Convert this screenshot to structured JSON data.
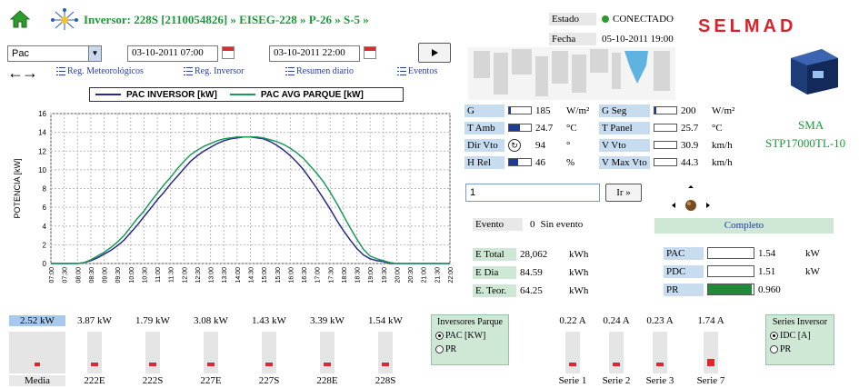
{
  "header": {
    "breadcrumb": "Inversor: 228S [2110054826] » EISEG-228 » P-26 » S-5 »"
  },
  "controls": {
    "variable_select": "Pac",
    "start_datetime": "03-10-2011 07:00",
    "end_datetime": "03-10-2011 22:00",
    "links": [
      "Reg. Meteorológicos",
      "Reg. Inversor",
      "Resumen diario",
      "Eventos"
    ]
  },
  "status": {
    "estado_label": "Estado",
    "estado_value": "CONECTADO",
    "fecha_label": "Fecha",
    "fecha_value": "05-10-2011 19:00",
    "brand": "SELMAD",
    "device_name_1": "SMA",
    "device_name_2": "STP17000TL-10",
    "status_color": "#2e9a2e"
  },
  "weather": {
    "left": [
      {
        "label": "G",
        "value": "185",
        "unit": "W/m²",
        "level": 0.1
      },
      {
        "label": "T Amb",
        "value": "24.7",
        "unit": "°C",
        "level": 0.5
      },
      {
        "label": "Dir Vto",
        "value": "94",
        "unit": "°",
        "level": null
      },
      {
        "label": "H Rel",
        "value": "46",
        "unit": "%",
        "level": 0.4
      }
    ],
    "right": [
      {
        "label": "G Seg",
        "value": "200",
        "unit": "W/m²",
        "level": 0.1
      },
      {
        "label": "T Panel",
        "value": "25.7",
        "unit": "°C",
        "level": 0.0
      },
      {
        "label": "V Vto",
        "value": "30.9",
        "unit": "km/h",
        "level": 0.0
      },
      {
        "label": "V Max Vto",
        "value": "44.3",
        "unit": "km/h",
        "level": 0.0
      }
    ]
  },
  "search": {
    "value": "1",
    "go_label": "Ir »"
  },
  "evento": {
    "label": "Evento",
    "count": "0",
    "text": "Sin evento"
  },
  "completo": {
    "label": "Completo",
    "rows": [
      {
        "label": "PAC",
        "value": "1.54",
        "unit": "kW",
        "level": 0.0
      },
      {
        "label": "PDC",
        "value": "1.51",
        "unit": "kW",
        "level": 0.0
      },
      {
        "label": "PR",
        "value": "0.960",
        "unit": "",
        "level": 0.96
      }
    ]
  },
  "energy": [
    {
      "label": "E Total",
      "value": "28,062",
      "unit": "kWh"
    },
    {
      "label": "E Dia",
      "value": "84.59",
      "unit": "kWh"
    },
    {
      "label": "E. Teor.",
      "value": "64.25",
      "unit": "kWh"
    }
  ],
  "inverters": [
    {
      "value": "2.52 kW",
      "name": "Media"
    },
    {
      "value": "3.87 kW",
      "name": "222E"
    },
    {
      "value": "1.79 kW",
      "name": "222S"
    },
    {
      "value": "3.08 kW",
      "name": "227E"
    },
    {
      "value": "1.43 kW",
      "name": "227S"
    },
    {
      "value": "3.39 kW",
      "name": "228E"
    },
    {
      "value": "1.54 kW",
      "name": "228S"
    }
  ],
  "inversores_parque": {
    "title": "Inversores Parque",
    "options": [
      "PAC [KW]",
      "PR"
    ],
    "selected": 0
  },
  "series": [
    {
      "value": "0.22 A",
      "name": "Serie 1"
    },
    {
      "value": "0.24 A",
      "name": "Serie 2"
    },
    {
      "value": "0.23 A",
      "name": "Serie 3"
    },
    {
      "value": "1.74 A",
      "name": "Serie 7"
    }
  ],
  "series_inversor": {
    "title": "Series Inversor",
    "options": [
      "IDC [A]",
      "PR"
    ],
    "selected": 0
  },
  "chart_data": {
    "type": "line",
    "title": "",
    "xlabel": "",
    "ylabel": "POTENCIA [kW]",
    "ylim": [
      0,
      16
    ],
    "yticks": [
      0,
      2,
      4,
      6,
      8,
      10,
      12,
      14,
      16
    ],
    "x_ticks": [
      "07:00",
      "07:30",
      "08:00",
      "08:30",
      "09:00",
      "09:30",
      "10:00",
      "10:30",
      "11:00",
      "11:30",
      "12:00",
      "12:30",
      "13:00",
      "13:30",
      "14:00",
      "14:30",
      "15:00",
      "15:30",
      "16:00",
      "16:30",
      "17:00",
      "17:30",
      "18:00",
      "18:30",
      "19:00",
      "19:30",
      "20:00",
      "20:30",
      "21:00",
      "21:30",
      "22:00"
    ],
    "grid": true,
    "legend_position": "top",
    "series": [
      {
        "name": "PAC INVERSOR [kW]",
        "color": "#2a2a8a",
        "x": [
          "07:00",
          "07:30",
          "08:00",
          "08:15",
          "08:30",
          "08:45",
          "09:00",
          "09:15",
          "09:30",
          "09:45",
          "10:00",
          "10:15",
          "10:30",
          "10:45",
          "11:00",
          "11:15",
          "11:30",
          "11:45",
          "12:00",
          "12:15",
          "12:30",
          "12:45",
          "13:00",
          "13:15",
          "13:30",
          "13:45",
          "14:00",
          "14:15",
          "14:30",
          "14:45",
          "15:00",
          "15:15",
          "15:30",
          "15:45",
          "16:00",
          "16:15",
          "16:30",
          "16:45",
          "17:00",
          "17:15",
          "17:30",
          "17:45",
          "18:00",
          "18:15",
          "18:30",
          "18:45",
          "19:00",
          "19:15",
          "19:30",
          "19:45",
          "20:00",
          "20:30",
          "21:00",
          "21:30",
          "22:00"
        ],
        "y": [
          0,
          0,
          0,
          0.1,
          0.3,
          0.6,
          1.0,
          1.4,
          1.9,
          2.5,
          3.3,
          4.1,
          5.0,
          5.9,
          6.8,
          7.6,
          8.5,
          9.3,
          10.1,
          10.9,
          11.5,
          12.0,
          12.4,
          12.8,
          13.1,
          13.3,
          13.4,
          13.5,
          13.5,
          13.4,
          13.3,
          13.0,
          12.6,
          12.1,
          11.5,
          10.8,
          10.0,
          9.0,
          8.0,
          6.9,
          5.8,
          4.6,
          3.5,
          2.5,
          1.6,
          0.9,
          0.5,
          0.3,
          0.2,
          0.0,
          0,
          0,
          0,
          0,
          0
        ]
      },
      {
        "name": "PAC AVG PARQUE [kW]",
        "color": "#1a9a5a",
        "x": [
          "07:00",
          "07:30",
          "08:00",
          "08:15",
          "08:30",
          "08:45",
          "09:00",
          "09:15",
          "09:30",
          "09:45",
          "10:00",
          "10:15",
          "10:30",
          "10:45",
          "11:00",
          "11:15",
          "11:30",
          "11:45",
          "12:00",
          "12:15",
          "12:30",
          "12:45",
          "13:00",
          "13:15",
          "13:30",
          "13:45",
          "14:00",
          "14:15",
          "14:30",
          "14:45",
          "15:00",
          "15:15",
          "15:30",
          "15:45",
          "16:00",
          "16:15",
          "16:30",
          "16:45",
          "17:00",
          "17:15",
          "17:30",
          "17:45",
          "18:00",
          "18:15",
          "18:30",
          "18:45",
          "19:00",
          "19:15",
          "19:30",
          "19:45",
          "20:00",
          "20:30",
          "21:00",
          "21:30",
          "22:00"
        ],
        "y": [
          0,
          0,
          0,
          0.1,
          0.4,
          0.8,
          1.2,
          1.7,
          2.3,
          3.0,
          3.9,
          4.8,
          5.6,
          6.6,
          7.5,
          8.4,
          9.2,
          10.1,
          10.9,
          11.6,
          12.1,
          12.5,
          12.8,
          13.1,
          13.3,
          13.4,
          13.5,
          13.5,
          13.5,
          13.5,
          13.4,
          13.2,
          13.0,
          12.7,
          12.3,
          11.8,
          11.2,
          10.4,
          9.6,
          8.7,
          7.6,
          6.4,
          5.1,
          3.8,
          2.6,
          1.5,
          0.8,
          0.5,
          0.3,
          0.1,
          0,
          0,
          0,
          0,
          0
        ]
      }
    ]
  }
}
